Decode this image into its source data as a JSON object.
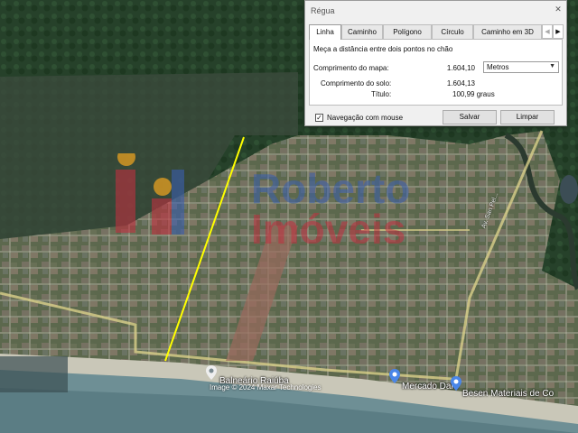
{
  "dialog": {
    "title": "Régua",
    "tabs": [
      {
        "label": "Linha",
        "active": true
      },
      {
        "label": "Caminho",
        "active": false
      },
      {
        "label": "Polígono",
        "active": false
      },
      {
        "label": "Círculo",
        "active": false
      },
      {
        "label": "Caminho em 3D",
        "active": false
      }
    ],
    "instruction": "Meça a distância entre dois pontos no chão",
    "map_length_label": "Comprimento do mapa:",
    "map_length_value": "1.604,10",
    "unit_selected": "Metros",
    "ground_length_label": "Comprimento do solo:",
    "ground_length_value": "1.604,13",
    "heading_label": "Título:",
    "heading_value": "100,99 graus",
    "mouse_nav_label": "Navegação com mouse",
    "mouse_nav_checked": true,
    "save_label": "Salvar",
    "clear_label": "Limpar"
  },
  "map": {
    "places": [
      {
        "name": "Balneário Raiúba"
      },
      {
        "name": "Mercado Daiu"
      },
      {
        "name": "Besen Materiais de Co"
      }
    ],
    "street_label": "Av. San Pel...",
    "copyright": "Image © 2024 Maxar Technologies",
    "measure_line_color": "#ffff00"
  },
  "watermark": {
    "line1": "Roberto",
    "line2": "Imóveis"
  }
}
